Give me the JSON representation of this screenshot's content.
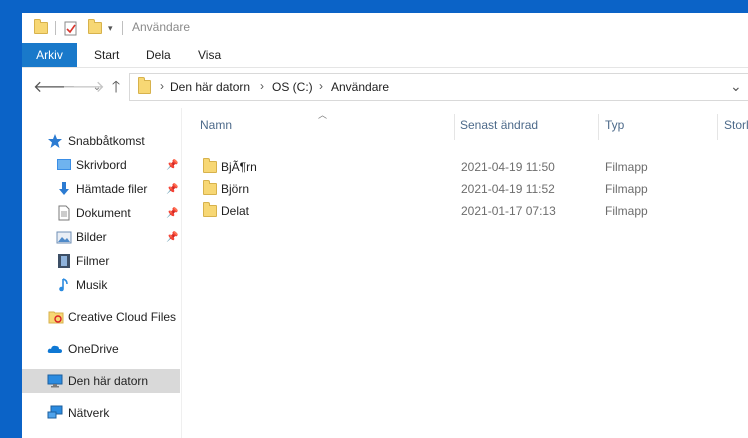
{
  "window": {
    "title": "Användare"
  },
  "ribbon": {
    "tabs": [
      {
        "label": "Arkiv",
        "active": true
      },
      {
        "label": "Start"
      },
      {
        "label": "Dela"
      },
      {
        "label": "Visa"
      }
    ]
  },
  "address": {
    "crumbs": [
      "Den här datorn",
      "OS (C:)",
      "Användare"
    ]
  },
  "sidebar": {
    "items": [
      {
        "label": "Snabbåtkomst",
        "icon": "star-icon"
      },
      {
        "label": "Skrivbord",
        "icon": "desktop-icon",
        "pinned": true
      },
      {
        "label": "Hämtade filer",
        "icon": "download-icon",
        "pinned": true
      },
      {
        "label": "Dokument",
        "icon": "document-icon",
        "pinned": true
      },
      {
        "label": "Bilder",
        "icon": "pictures-icon",
        "pinned": true
      },
      {
        "label": "Filmer",
        "icon": "film-icon"
      },
      {
        "label": "Musik",
        "icon": "music-icon"
      },
      {
        "label": "Creative Cloud Files",
        "icon": "creative-cloud-folder-icon"
      },
      {
        "label": "OneDrive",
        "icon": "cloud-icon"
      },
      {
        "label": "Den här datorn",
        "icon": "computer-icon",
        "selected": true
      },
      {
        "label": "Nätverk",
        "icon": "network-icon"
      }
    ]
  },
  "columns": [
    "Namn",
    "Senast ändrad",
    "Typ",
    "Storl"
  ],
  "files": [
    {
      "name": "BjÃ¶rn",
      "date": "2021-04-19 11:50",
      "type": "Filmapp"
    },
    {
      "name": "Björn",
      "date": "2021-04-19 11:52",
      "type": "Filmapp"
    },
    {
      "name": "Delat",
      "date": "2021-01-17 07:13",
      "type": "Filmapp"
    }
  ],
  "colors": {
    "accent": "#1979ca",
    "desktop": "#0b63c7",
    "folder": "#f7d774",
    "selection": "#d9d9d9"
  }
}
